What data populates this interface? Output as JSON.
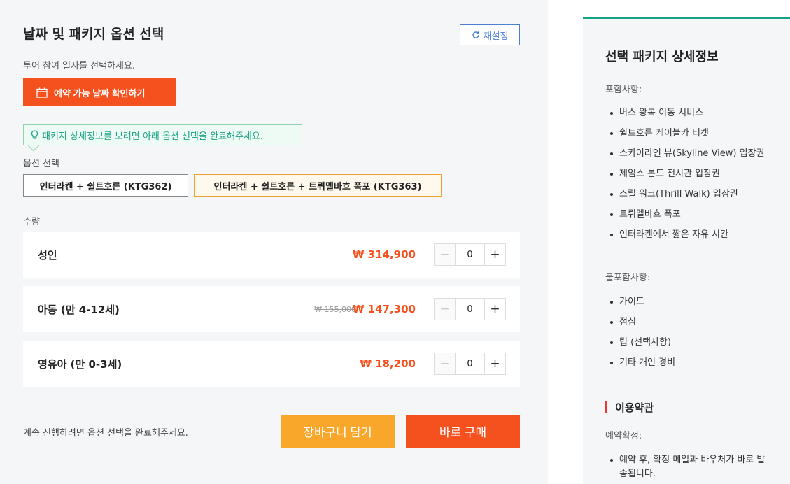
{
  "main": {
    "title": "날짜 및 패키지 옵션 선택",
    "reset_label": "재설정",
    "date_hint": "투어 참여 일자를 선택하세요.",
    "date_button_label": "예약 가능 날짜 확인하기",
    "tooltip_text": "패키지 상세정보를 보려면 아래 옵션 선택을 완료해주세요.",
    "options_label": "옵션 선택",
    "options": [
      "인터라켄 + 쉴트호른 (KTG362)",
      "인터라켄 + 쉴트호른 + 트뤼멜바흐 폭포 (KTG363)"
    ],
    "quantity_label": "수량",
    "rows": [
      {
        "name": "성인",
        "price": "₩ 314,900",
        "original_price": "",
        "qty": "0"
      },
      {
        "name": "아동 (만 4-12세)",
        "price": "₩ 147,300",
        "original_price": "₩ 155,000",
        "qty": "0"
      },
      {
        "name": "영유아 (만 0-3세)",
        "price": "₩ 18,200",
        "original_price": "",
        "qty": "0"
      }
    ],
    "minus_symbol": "−",
    "plus_symbol": "+",
    "bottom_hint": "계속 진행하려면 옵션 선택을 완료해주세요.",
    "cart_label": "장바구니 담기",
    "buy_label": "바로 구매"
  },
  "detail": {
    "title": "선택 패키지 상세정보",
    "included_label": "포함사항:",
    "included": [
      "버스 왕복 이동 서비스",
      "쉴트호른 케이블카 티켓",
      "스카이라인 뷰(Skyline View) 입장권",
      "제임스 본드 전시관 입장권",
      "스릴 워크(Thrill Walk) 입장권",
      "트뤼멜바흐 폭포",
      "인터라켄에서 짧은 자유 시간"
    ],
    "excluded_label": "불포함사항:",
    "excluded": [
      "가이드",
      "점심",
      "팁 (선택사항)",
      "기타 개인 경비"
    ],
    "terms_title": "이용약관",
    "confirm_label": "예약확정:",
    "confirm_items": [
      "예약 후, 확정 메일과 바우처가 바로 발송됩니다."
    ]
  },
  "colors": {
    "accent": "#f5511e",
    "cart": "#f9a72b",
    "teal": "#16a085",
    "reset_blue": "#4a7fd4"
  },
  "icons": [
    "refresh-icon",
    "calendar-icon",
    "lightbulb-icon"
  ]
}
